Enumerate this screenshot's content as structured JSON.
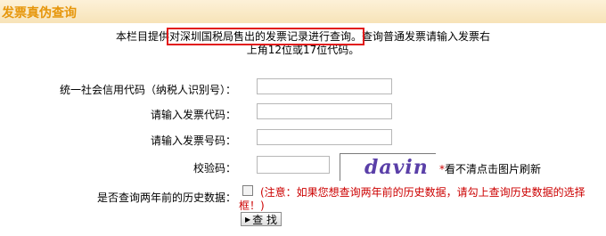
{
  "header": {
    "title": "发票真伪查询"
  },
  "intro": {
    "prefix": "本栏目提供",
    "highlight": "对深圳国税局售出的发票记录进行查询。",
    "suffix": "查询普通发票请输入发票右",
    "line2": "上角12位或17位代码。"
  },
  "form": {
    "credit_code_label": "统一社会信用代码（纳税人识别号）：",
    "credit_code_value": "",
    "invoice_code_label": "请输入发票代码：",
    "invoice_code_value": "",
    "invoice_number_label": "请输入发票号码：",
    "invoice_number_value": "",
    "captcha_label": "校验码：",
    "captcha_value": "",
    "captcha_image_text": "davin",
    "captcha_hint_star": "*",
    "captcha_hint": "看不清点击图片刷新",
    "history_label": "是否查询两年前的历史数据：",
    "history_checked": false,
    "history_note": "(注意：如果您想查询两年前的历史数据，请勾上查询历史数据的选择框！)",
    "submit_label": "查 找"
  }
}
